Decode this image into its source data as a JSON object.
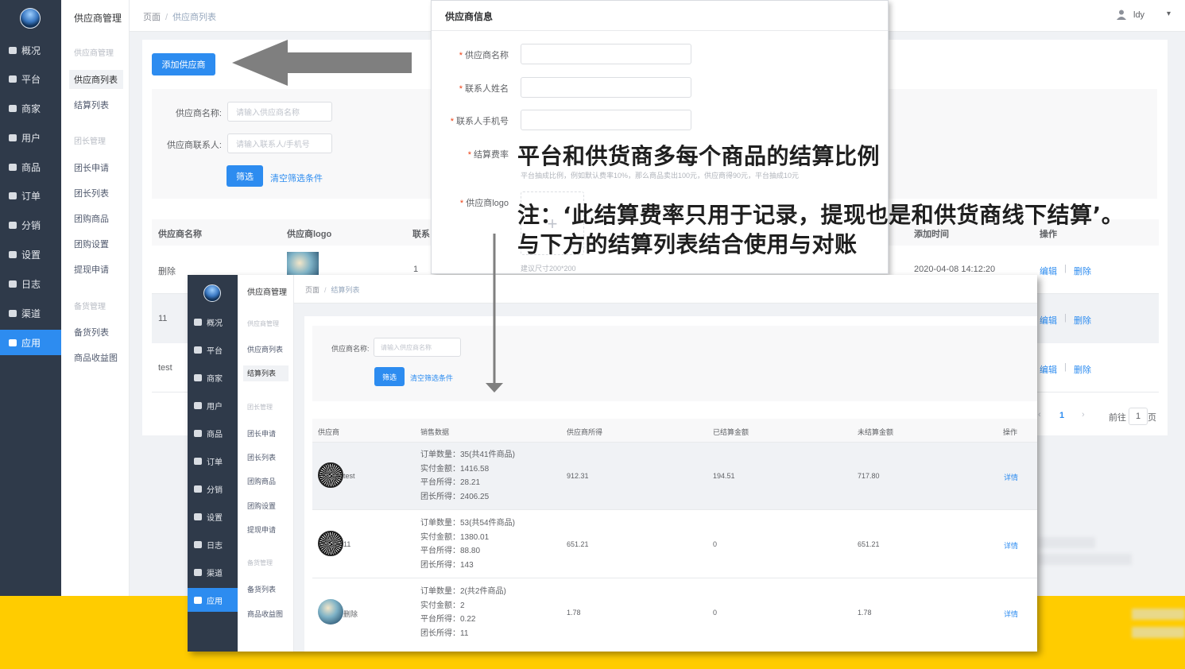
{
  "background_colors": {
    "accent": "#2d8cf0",
    "sidebar": "#2f3a4a",
    "slide_bg": "#ffcc00"
  },
  "nav": {
    "items": [
      {
        "label": "概况",
        "icon": "monitor-icon"
      },
      {
        "label": "平台",
        "icon": "desktop-icon"
      },
      {
        "label": "商家",
        "icon": "store-icon"
      },
      {
        "label": "用户",
        "icon": "user-icon"
      },
      {
        "label": "商品",
        "icon": "product-icon"
      },
      {
        "label": "订单",
        "icon": "order-icon"
      },
      {
        "label": "分销",
        "icon": "distribution-icon"
      },
      {
        "label": "设置",
        "icon": "gear-icon"
      },
      {
        "label": "日志",
        "icon": "log-icon"
      },
      {
        "label": "渠道",
        "icon": "channel-icon"
      },
      {
        "label": "应用",
        "icon": "grid-icon"
      }
    ]
  },
  "submenu": {
    "title": "供应商管理",
    "group1": "供应商管理",
    "supplier_list": "供应商列表",
    "settlement_list": "结算列表",
    "group2": "团长管理",
    "leader_apply": "团长申请",
    "leader_list": "团长列表",
    "group_goods": "团购商品",
    "group_settings": "团购设置",
    "withdraw_apply": "提现申请",
    "group3": "备货管理",
    "stock_list": "备货列表",
    "goods_income_chart": "商品收益图"
  },
  "header": {
    "crumb_root": "页面",
    "crumb_sep": "/",
    "crumb_current": "供应商列表",
    "user_name": "ldy",
    "dropdown_caret": "▾"
  },
  "back_page": {
    "add_button": "添加供应商",
    "filter": {
      "name_label": "供应商名称:",
      "name_placeholder": "请输入供应商名称",
      "contact_label": "供应商联系人:",
      "contact_placeholder": "请输入联系人/手机号",
      "filter_button": "筛选",
      "clear_link": "清空筛选条件"
    },
    "table": {
      "headers": [
        "供应商名称",
        "供应商logo",
        "联系",
        "添加时间",
        "操作"
      ],
      "rows": [
        {
          "name": "删除",
          "contact": "1",
          "time": "2020-04-08 14:12:20"
        },
        {
          "name": "11"
        },
        {
          "name": "test"
        }
      ],
      "edit": "编辑",
      "divider": "|",
      "delete": "删除"
    },
    "pagination": {
      "prev": "‹",
      "page": "1",
      "next": "›",
      "goto_label": "前往",
      "goto_value": "1",
      "page_unit": "页"
    }
  },
  "dialog": {
    "title": "供应商信息",
    "required_mark": "*",
    "field_name": "供应商名称",
    "field_contact": "联系人姓名",
    "field_phone": "联系人手机号",
    "field_rate": "结算费率",
    "rate_hint": "平台抽成比例，例如默认费率10%，那么商品卖出100元，供应商得90元，平台抽成10元",
    "field_logo": "供应商logo",
    "upload_plus": "+",
    "logo_hint": "建议尺寸200*200"
  },
  "annotations": {
    "caption1": "平台和供货商多每个商品的结算比例",
    "caption2_line1": "注：‘此结算费率只用于记录，提现也是和供货商线下结算’。",
    "caption2_line2": "与下方的结算列表结合使用与对账"
  },
  "front_page": {
    "crumb_root": "页面",
    "crumb_sep": "/",
    "crumb_current": "结算列表",
    "filter": {
      "name_label": "供应商名称:",
      "name_placeholder": "请输入供应商名称",
      "filter_button": "筛选",
      "clear_link": "清空筛选条件"
    },
    "table": {
      "headers": [
        "供应商",
        "销售数据",
        "供应商所得",
        "已结算金额",
        "未结算金额",
        "操作"
      ],
      "rows": [
        {
          "supplier": "test",
          "order_count": "订单数量：35(共41件商品)",
          "paid": "实付金额：1416.58",
          "platform": "平台所得：28.21",
          "leader": "团长所得：2406.25",
          "supplier_income": "912.31",
          "settled": "194.51",
          "unsettled": "717.80",
          "action": "详情"
        },
        {
          "supplier": "11",
          "order_count": "订单数量：53(共54件商品)",
          "paid": "实付金额：1380.01",
          "platform": "平台所得：88.80",
          "leader": "团长所得：143",
          "supplier_income": "651.21",
          "settled": "0",
          "unsettled": "651.21",
          "action": "详情"
        },
        {
          "supplier": "删除",
          "order_count": "订单数量：2(共2件商品)",
          "paid": "实付金额：2",
          "platform": "平台所得：0.22",
          "leader": "团长所得：11",
          "supplier_income": "1.78",
          "settled": "0",
          "unsettled": "1.78",
          "action": "详情"
        }
      ]
    }
  }
}
